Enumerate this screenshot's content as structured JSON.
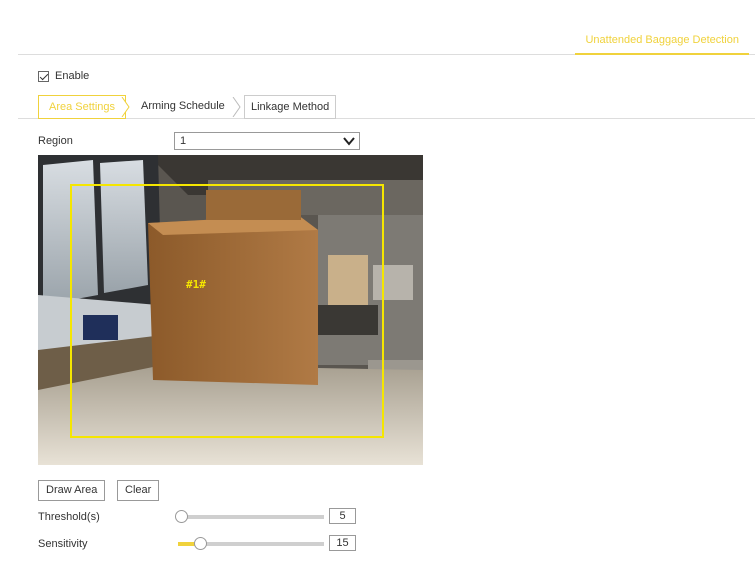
{
  "header": {
    "active_tab": "Unattended Baggage Detection"
  },
  "enable": {
    "label": "Enable",
    "checked": true
  },
  "sub_tabs": {
    "area_settings": "Area Settings",
    "arming_schedule": "Arming Schedule",
    "linkage_method": "Linkage Method",
    "active": "Area Settings"
  },
  "region": {
    "label": "Region",
    "value": "1"
  },
  "video": {
    "region_tag": "#1#"
  },
  "buttons": {
    "draw_area": "Draw Area",
    "clear": "Clear"
  },
  "threshold": {
    "label": "Threshold(s)",
    "value": "5",
    "fraction": 0.02
  },
  "sensitivity": {
    "label": "Sensitivity",
    "value": "15",
    "fraction": 0.15
  },
  "colors": {
    "accent": "#f0d23c",
    "border": "#dddddd"
  }
}
